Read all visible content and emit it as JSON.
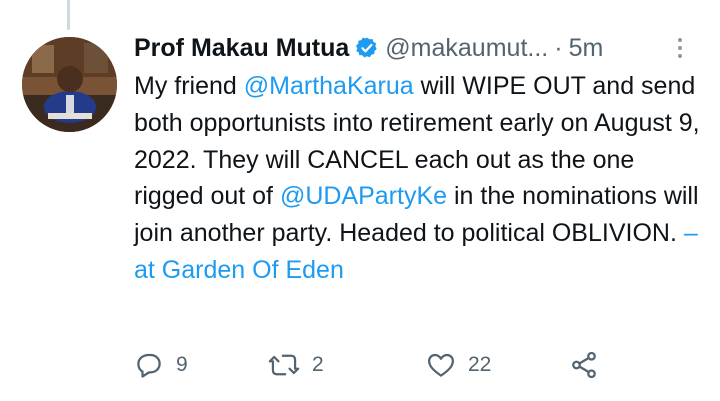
{
  "tweet": {
    "author_name": "Prof Makau Mutua",
    "handle": "@makaumut...",
    "separator": "·",
    "time": "5m",
    "text_parts": {
      "t1": "My friend ",
      "m1": "@MarthaKarua",
      "t2": " will WIPE OUT and send both opportunists into retirement early on August 9, 2022.  They will CANCEL each out as the one rigged out of ",
      "m2": "@UDAPartyKe",
      "t3": " in the nominations will join another party. Headed to political OBLIVION. ",
      "location": "– at Garden Of Eden"
    }
  },
  "actions": {
    "reply_count": "9",
    "retweet_count": "2",
    "like_count": "22"
  },
  "icons": {
    "verified": "verified-badge-icon",
    "more": "more-options-icon",
    "reply": "reply-icon",
    "retweet": "retweet-icon",
    "like": "heart-icon",
    "share": "share-icon"
  },
  "colors": {
    "link": "#1d9bf0",
    "secondary_text": "#536471",
    "primary_text": "#0f1419",
    "thread_line": "#cfd9de"
  }
}
